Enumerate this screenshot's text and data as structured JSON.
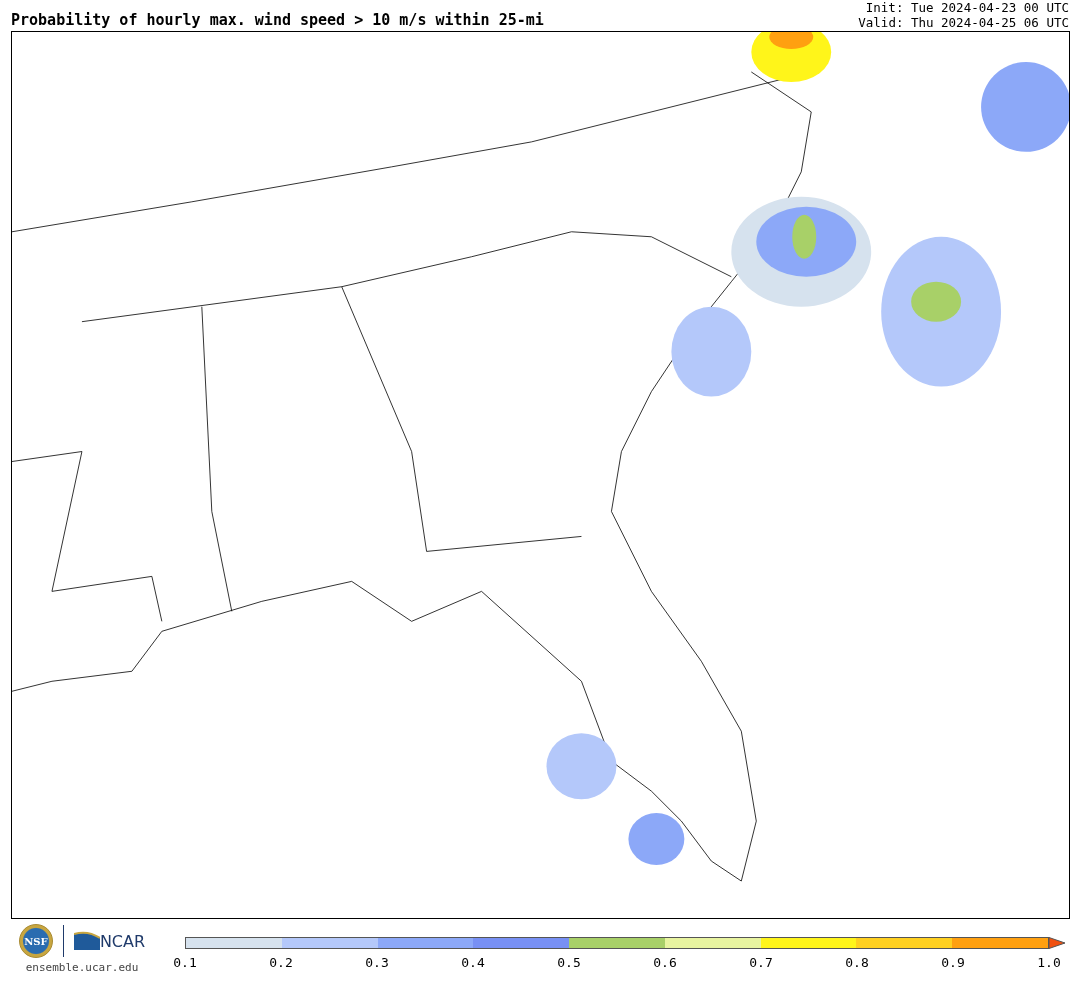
{
  "header": {
    "title": "Probability of hourly max. wind speed > 10 m/s within 25-mi",
    "init": "Init: Tue 2024-04-23 00 UTC",
    "valid": "Valid: Thu 2024-04-25 06 UTC"
  },
  "footer": {
    "seal_text": "NSF",
    "org_text": "NCAR",
    "site": "ensemble.ucar.edu"
  },
  "colorbar": {
    "extend_arrow": {
      "color": "#f05010"
    },
    "bins": [
      {
        "color": "#d6e2ee"
      },
      {
        "color": "#b4c8fa"
      },
      {
        "color": "#8ca8f8"
      },
      {
        "color": "#7890f4"
      },
      {
        "color": "#a8d068"
      },
      {
        "color": "#e8f4a0"
      },
      {
        "color": "#fff51a"
      },
      {
        "color": "#ffd020"
      },
      {
        "color": "#ffa010"
      }
    ],
    "ticks": [
      "0.1",
      "0.2",
      "0.3",
      "0.4",
      "0.5",
      "0.6",
      "0.7",
      "0.8",
      "0.9",
      "1.0"
    ]
  }
}
